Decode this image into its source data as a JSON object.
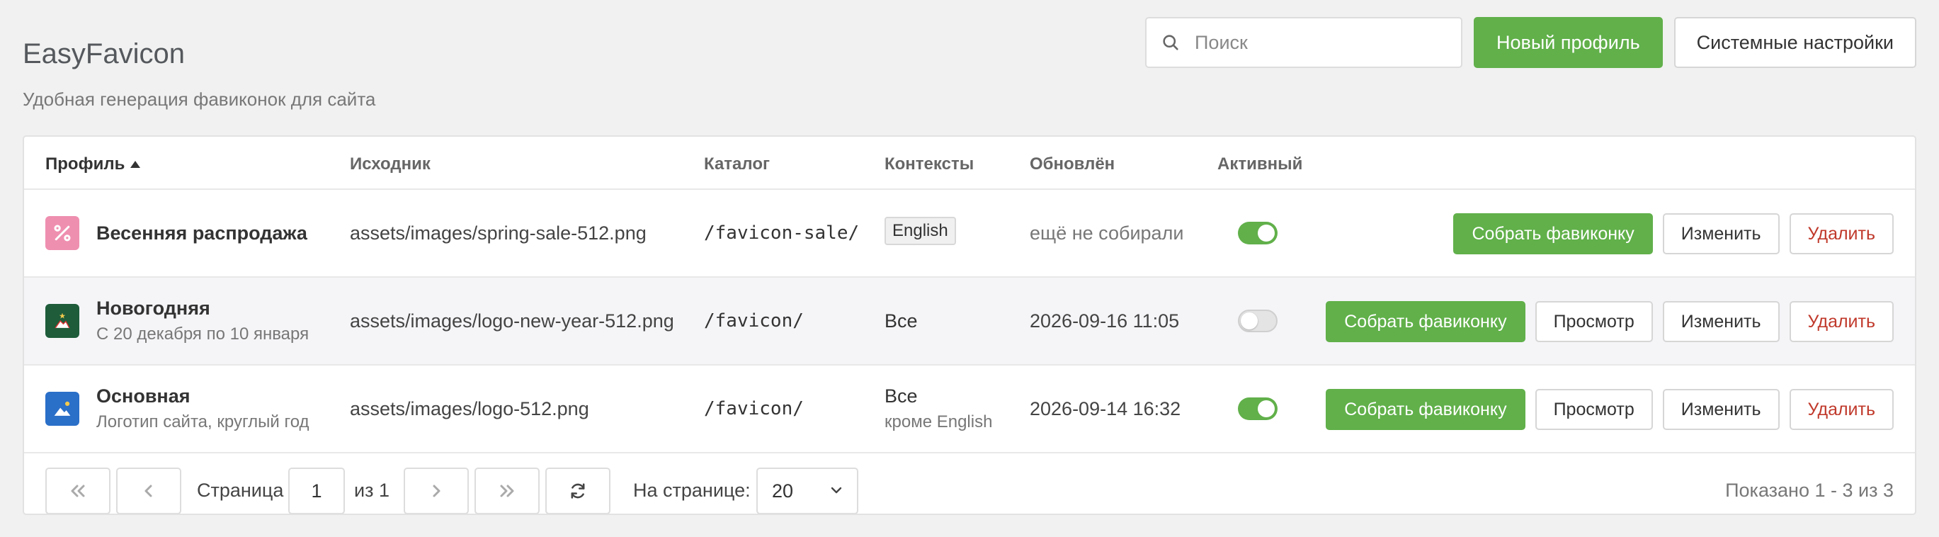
{
  "header": {
    "title": "EasyFavicon",
    "subtitle": "Удобная генерация фавиконок для сайта"
  },
  "search": {
    "placeholder": "Поиск",
    "value": ""
  },
  "toolbar": {
    "new_profile_label": "Новый профиль",
    "settings_label": "Системные настройки"
  },
  "table": {
    "columns": {
      "profile": "Профиль",
      "source": "Исходник",
      "catalog": "Каталог",
      "contexts": "Контексты",
      "updated": "Обновлён",
      "active": "Активный"
    },
    "sort": {
      "column": "profile",
      "direction": "asc"
    },
    "rows": [
      {
        "icon": "percent-icon",
        "icon_color": "#ef8fb0",
        "title": "Весенняя распродажа",
        "subtitle": "",
        "source": "assets/images/spring-sale-512.png",
        "catalog": "/favicon-sale/",
        "context": "English",
        "context_note": "",
        "updated": "ещё не собирали",
        "active": true,
        "build_label": "Собрать фавиконку",
        "edit_label": "Изменить",
        "delete_label": "Удалить"
      },
      {
        "icon": "new-year-image-icon",
        "icon_color": "#1e5c3a",
        "title": "Новогодняя",
        "subtitle": "С 20 декабря по 10 января",
        "source": "assets/images/logo-new-year-512.png",
        "catalog": "/favicon/",
        "context": "Все",
        "context_note": "",
        "updated": "2026-09-16 11:05",
        "active": false,
        "build_label": "Собрать фавиконку",
        "preview_label": "Просмотр",
        "edit_label": "Изменить",
        "delete_label": "Удалить"
      },
      {
        "icon": "image-icon",
        "icon_color": "#2a6fc8",
        "title": "Основная",
        "subtitle": "Логотип сайта, круглый год",
        "source": "assets/images/logo-512.png",
        "catalog": "/favicon/",
        "context": "Все",
        "context_note": "кроме English",
        "updated": "2026-09-14 16:32",
        "active": true,
        "build_label": "Собрать фавиконку",
        "preview_label": "Просмотр",
        "edit_label": "Изменить",
        "delete_label": "Удалить"
      }
    ]
  },
  "pagination": {
    "page_label": "Страница",
    "current_page": "1",
    "of_label": "из 1",
    "per_page_label": "На странице:",
    "per_page_value": "20",
    "shown_text": "Показано 1 - 3 из 3"
  },
  "colors": {
    "accent_green": "#61b04a",
    "danger_red": "#c0392b",
    "background": "#f1f1f1"
  }
}
